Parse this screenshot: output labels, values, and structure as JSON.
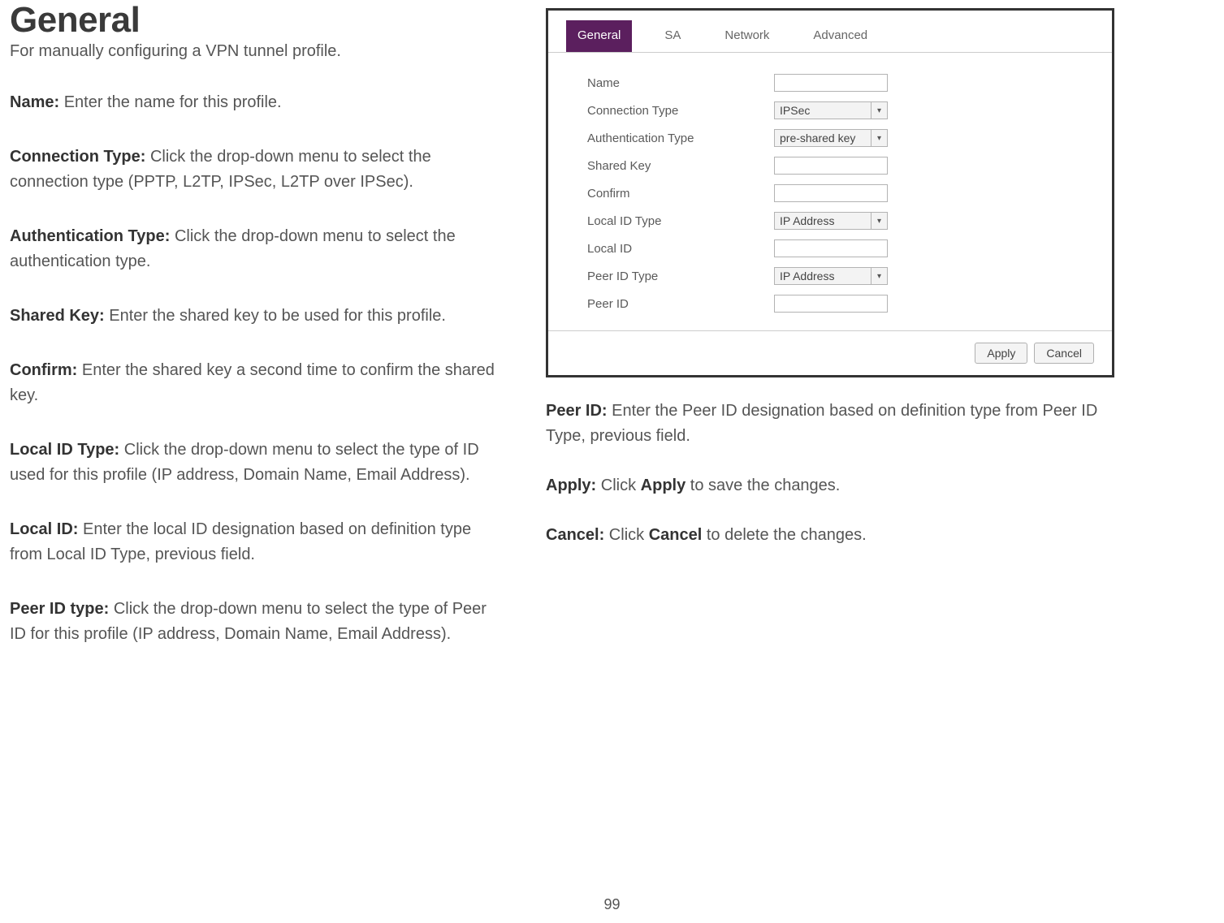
{
  "heading": "General",
  "intro": "For manually configuring a VPN tunnel profile.",
  "fields": {
    "name": {
      "label": "Name:",
      "desc": " Enter the name for this profile."
    },
    "conn": {
      "label": "Connection Type:",
      "desc": " Click the drop-down menu to select the connection type (PPTP, L2TP, IPSec, L2TP over IPSec)."
    },
    "auth": {
      "label": "Authentication Type:",
      "desc": " Click the drop-down menu to select the authentication type."
    },
    "shared": {
      "label": "Shared Key:",
      "desc": " Enter the shared key to be used for this profile."
    },
    "confirm": {
      "label": "Confirm:",
      "desc": " Enter the shared key a second time to confirm the shared key."
    },
    "localidtype": {
      "label": "Local ID Type:",
      "desc": " Click the drop-down menu to select the type of ID used for this profile (IP address, Domain Name, Email Address)."
    },
    "localid": {
      "label": "Local ID:",
      "desc": " Enter the local ID designation based on definition type from Local ID Type, previous field."
    },
    "peeridtype": {
      "label": "Peer ID type:",
      "desc": " Click the drop-down menu to select the type of Peer ID for this profile (IP address, Domain Name, Email Address)."
    },
    "peerid": {
      "label": "Peer ID:",
      "desc": " Enter the Peer ID designation based on definition type from Peer ID Type, previous field."
    },
    "apply": {
      "label": "Apply:",
      "desc_pre": " Click ",
      "desc_bold": "Apply",
      "desc_post": " to save the changes."
    },
    "cancel": {
      "label": "Cancel:",
      "desc_pre": " Click ",
      "desc_bold": "Cancel",
      "desc_post": " to delete the changes."
    }
  },
  "screenshot": {
    "tabs": [
      "General",
      "SA",
      "Network",
      "Advanced"
    ],
    "rows": {
      "name": "Name",
      "conn": "Connection Type",
      "auth": "Authentication Type",
      "shared": "Shared Key",
      "confirm": "Confirm",
      "localidtype": "Local ID Type",
      "localid": "Local ID",
      "peeridtype": "Peer ID Type",
      "peerid": "Peer ID"
    },
    "selects": {
      "conn": "IPSec",
      "auth": "pre-shared key",
      "localidtype": "IP Address",
      "peeridtype": "IP Address"
    },
    "buttons": {
      "apply": "Apply",
      "cancel": "Cancel"
    }
  },
  "page_number": "99"
}
